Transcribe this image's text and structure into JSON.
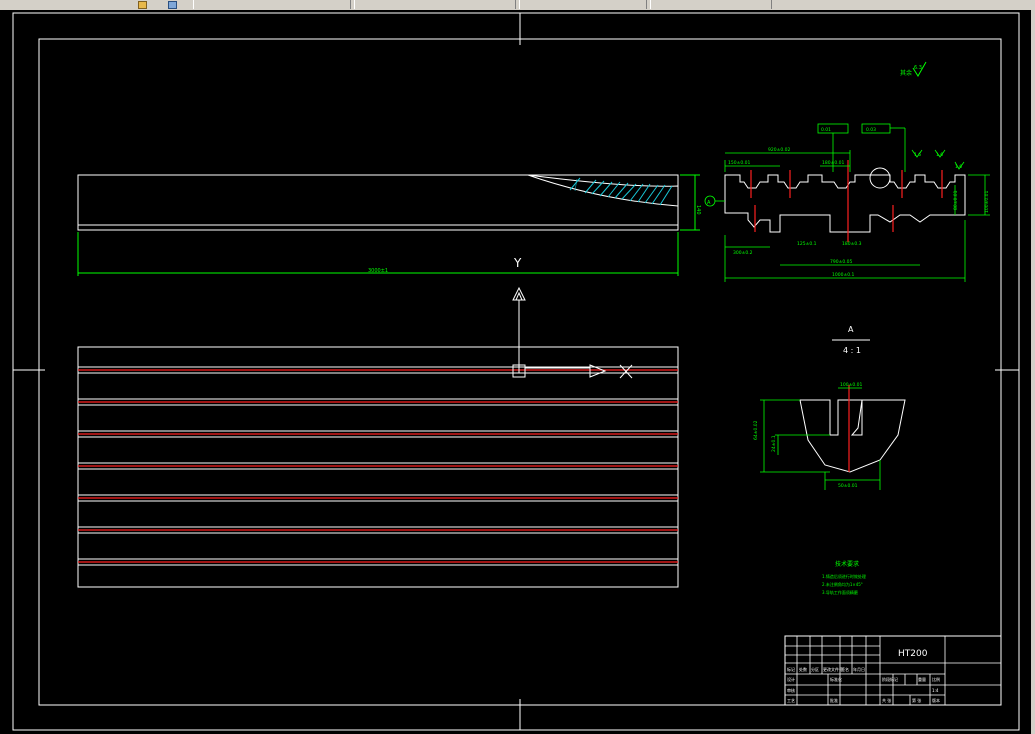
{
  "toolbar": {
    "tabs": [
      "",
      "",
      "",
      "",
      ""
    ]
  },
  "drawing": {
    "overall_length_dim": "3000±1",
    "section_height_dim": "140",
    "ucs_y": "Y",
    "ucs_x": "X",
    "datum_a": "A",
    "detail_title": "A",
    "detail_scale": "4 : 1",
    "material": "HT200",
    "roughness_label": "其余",
    "roughness_value": "6.3",
    "tech_req_title": "技术要求",
    "tech_req_lines": [
      "1.铸造后须进行时效处理",
      "2.未注倒角均为1×45°",
      "3.导轨工作面须精磨"
    ],
    "dims": {
      "top_overall": "920±0.02",
      "top_left": "150±0.01",
      "top_mid": "180±0.01",
      "bottom_left": "300±0.2",
      "slot1": "125±0.1",
      "slot2": "180±0.3",
      "bottom_span": "790±0.05",
      "bottom_total": "1000±0.1",
      "right_h1": "80±0.01",
      "right_h2": "100±0.01",
      "tol1": "0.01",
      "tol2": "0.03",
      "detail_top": "100±0.01",
      "detail_side": "64±0.02",
      "detail_bottom": "50±0.01",
      "detail_h2": "24±0.1",
      "rough_1": "1.6",
      "rough_2": "1.6",
      "rough_3": "1.6"
    },
    "title_block": {
      "rows_left": [
        "标记",
        "设计",
        "审核",
        "工艺"
      ],
      "header_cells": [
        "处数",
        "分区",
        "更改文件号",
        "签名",
        "年月日"
      ],
      "standard": "标准化",
      "approve": "批准",
      "stage": "阶段标记",
      "weight": "重量",
      "scale_label": "比例",
      "scale_value": "1:4",
      "sheets_a": "共 张",
      "sheets_b": "第 张",
      "version": "版本"
    }
  }
}
